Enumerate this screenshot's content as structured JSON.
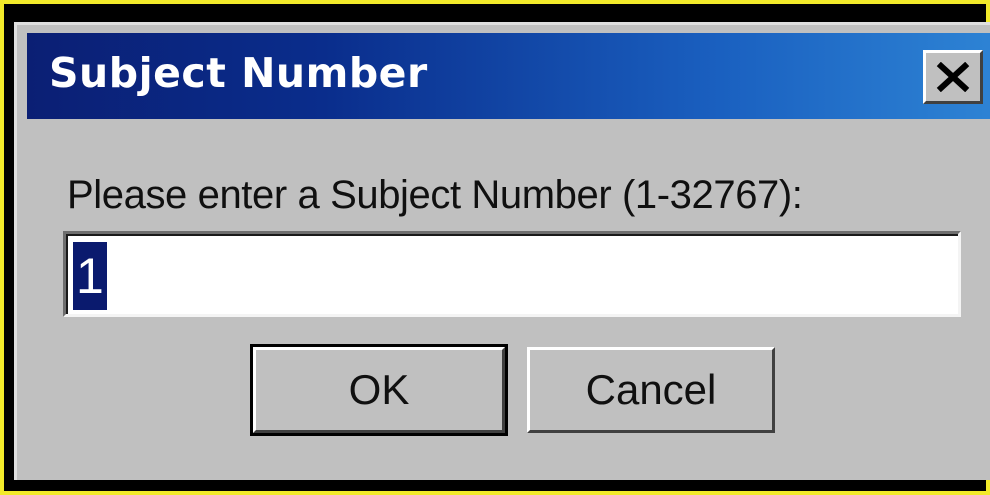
{
  "dialog": {
    "title": "Subject Number",
    "close_icon": "close-icon",
    "prompt": "Please enter a Subject Number (1-32767):",
    "input_value": "1",
    "ok_label": "OK",
    "cancel_label": "Cancel"
  },
  "colors": {
    "titlebar_start": "#0b1f74",
    "titlebar_end": "#2f86d6",
    "dialog_bg": "#c0c0c0",
    "frame": "#f2ea2a",
    "selection": "#0a1a6e"
  }
}
